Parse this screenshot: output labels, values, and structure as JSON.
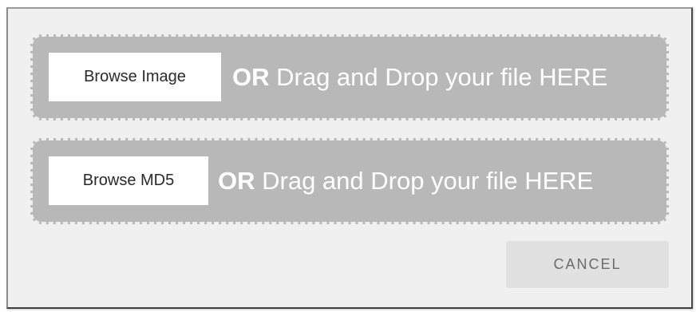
{
  "dialog": {
    "image_dropzone": {
      "browse_label": "Browse Image",
      "or_label": "OR",
      "drop_text": " Drag and Drop your file HERE"
    },
    "md5_dropzone": {
      "browse_label": "Browse MD5",
      "or_label": "OR",
      "drop_text": " Drag and Drop your file HERE"
    },
    "cancel_label": "CANCEL"
  },
  "colors": {
    "dialog_background": "#f0f0f0",
    "dropzone_fill": "#b8b8b8",
    "dropzone_border": "#efefef",
    "cancel_background": "#e1e1e1"
  }
}
